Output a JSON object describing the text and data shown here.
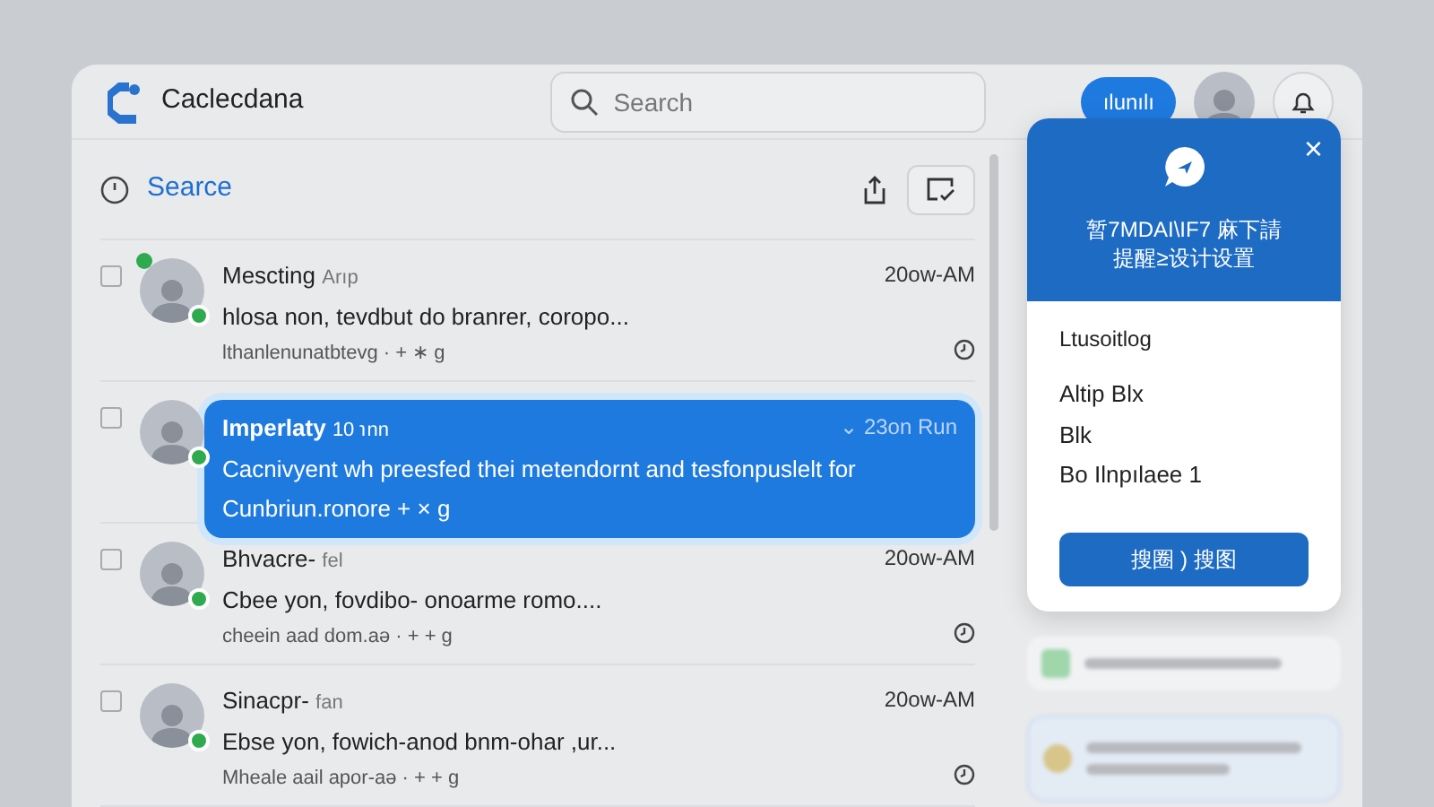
{
  "app": {
    "name": "Caclecdana"
  },
  "search": {
    "placeholder": "Search"
  },
  "header_button": "ılunılı",
  "toolbar": {
    "title": "Searce"
  },
  "messages": [
    {
      "sender": "Mescting",
      "meta": "Arıp",
      "time": "20ow-AM",
      "preview": "hlosa non, tevdbut do branrer, coropo...",
      "tags": "lthanlenunatbtevg · + ∗ g",
      "unread": true,
      "selected": false,
      "checked": false
    },
    {
      "sender": "Imperlaty",
      "meta": "10 ℩nn",
      "time": "⌄ 23on Run",
      "preview": "Cacnivyent wh preesfed thei metendornt and tesfonpuslelt for",
      "tags": "Cunbriun.ronore + × g",
      "unread": false,
      "selected": true,
      "checked": false
    },
    {
      "sender": "Bhvacre-",
      "meta": "fel",
      "time": "20ow-AM",
      "preview": "Cbee yon, fovdibo- onoarme romo....",
      "tags": "cheein aad dom.aǝ · + + g",
      "unread": false,
      "selected": false,
      "checked": false
    },
    {
      "sender": "Sinacpr-",
      "meta": "fan",
      "time": "20ow-AM",
      "preview": "Ebse yon, fowich-anod bnm-ohar ,ur...",
      "tags": "Mheale aail apor-aǝ · + + g",
      "unread": false,
      "selected": false,
      "checked": false
    }
  ],
  "popover": {
    "close": "×",
    "title_lines": [
      "暂7MDAI\\IF7 麻下請",
      "提醒≥设计设置"
    ],
    "heading": "Ltusoitlog",
    "lines": [
      "Altip Blx",
      "Blk",
      "Bo Ilnpılaee 1"
    ],
    "button": "搜圈 ) 搜图"
  }
}
